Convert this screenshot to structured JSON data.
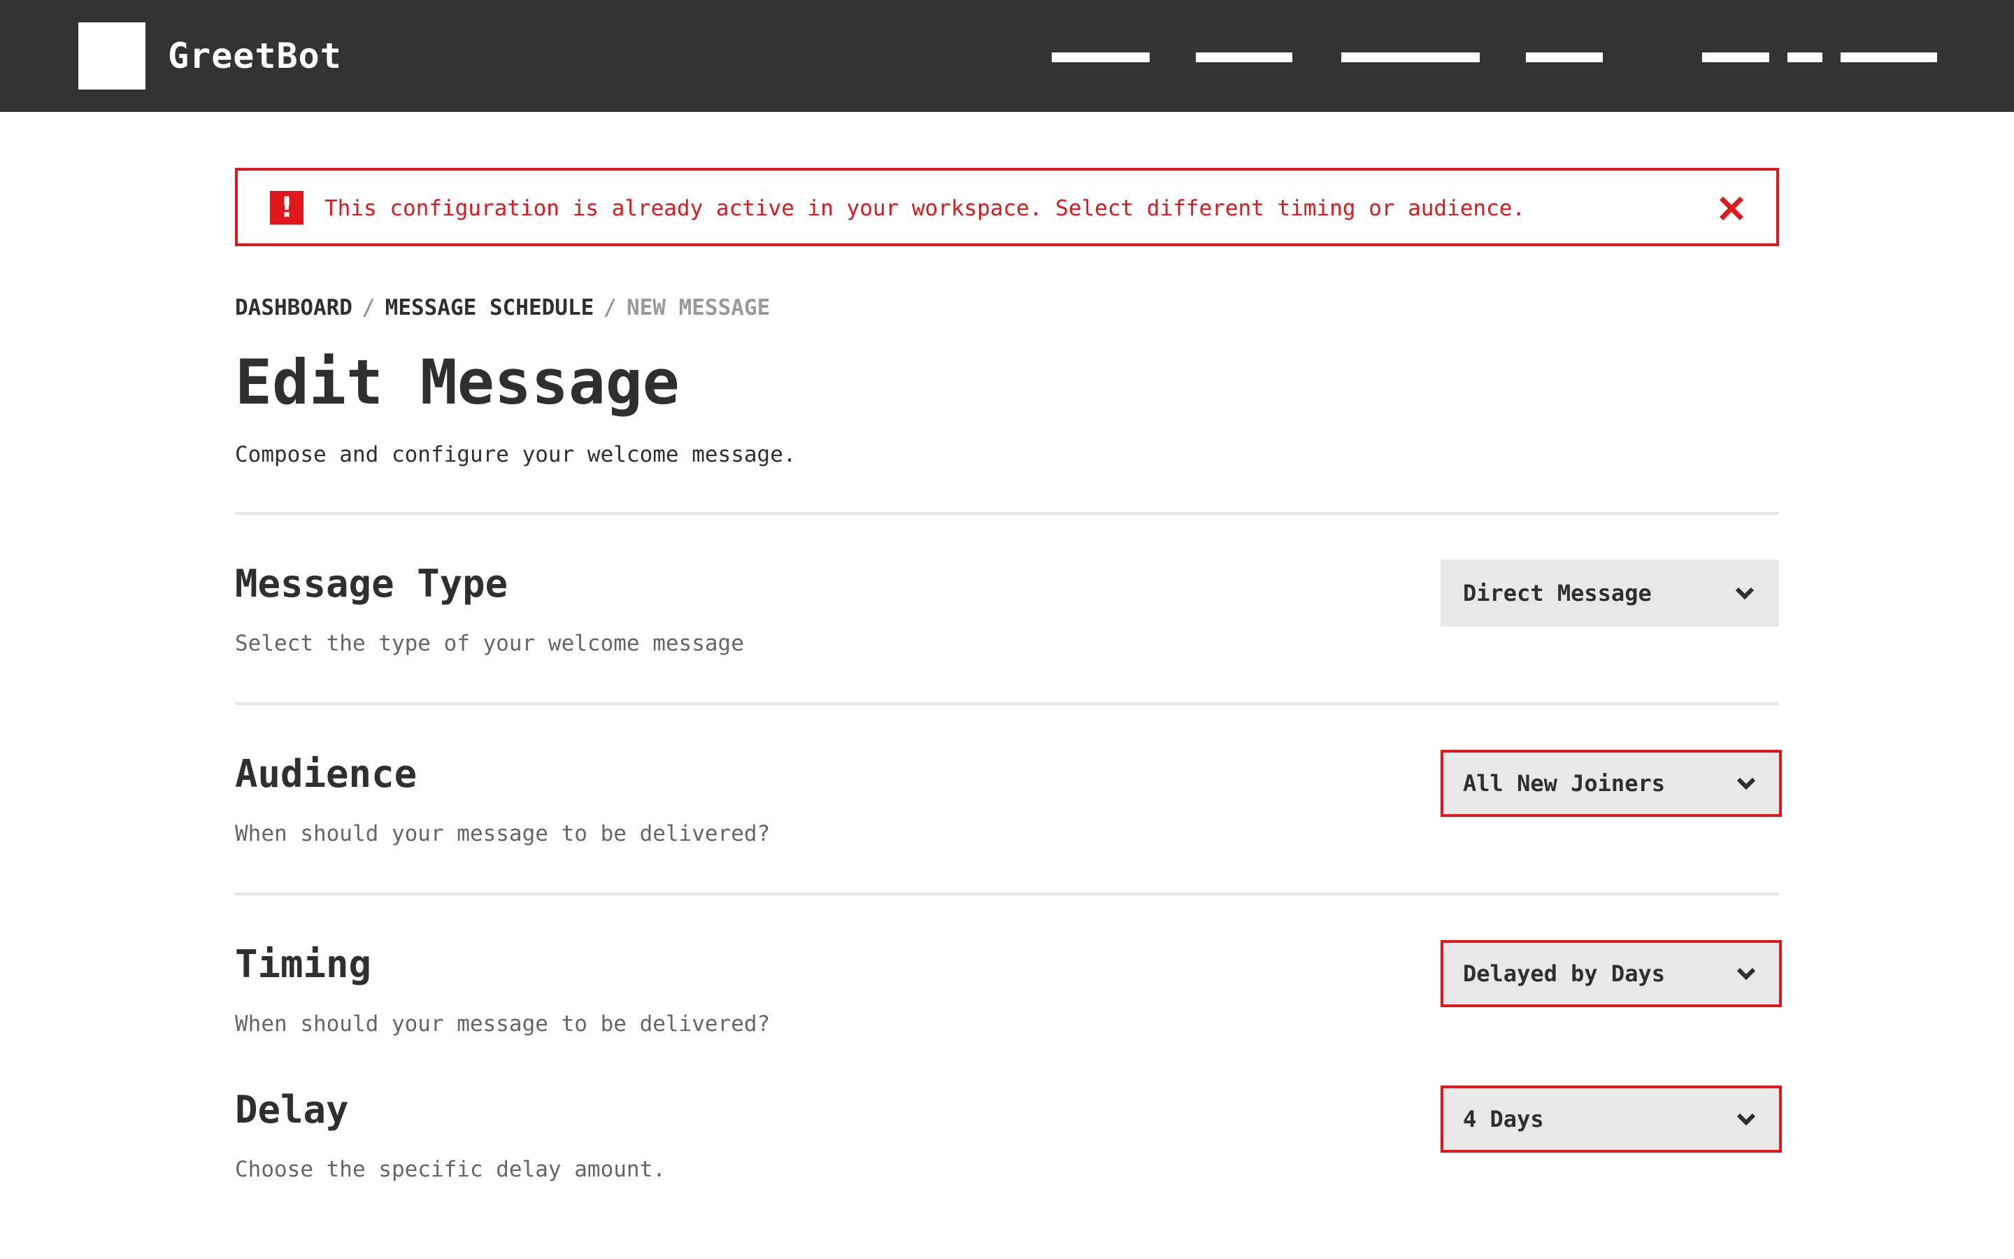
{
  "header": {
    "brand": "GreetBot",
    "nav_items": [
      "nav-link-1",
      "nav-link-2",
      "nav-link-3",
      "nav-link-4",
      "account-link-1",
      "account-link-2",
      "account-link-3"
    ]
  },
  "alert": {
    "message": "This configuration is already active in your workspace. Select different timing or audience.",
    "icon": "exclamation-icon",
    "close_icon": "close-icon",
    "color": "#e0181b"
  },
  "breadcrumb": {
    "items": [
      "DASHBOARD",
      "MESSAGE SCHEDULE"
    ],
    "separator": "/",
    "current": "NEW MESSAGE"
  },
  "page": {
    "title": "Edit Message",
    "subtitle": "Compose and configure your welcome message."
  },
  "settings": [
    {
      "title": "Message Type",
      "description": "Select the type of your welcome message",
      "value": "Direct Message",
      "has_error": false
    },
    {
      "title": "Audience",
      "description": "When should your message to be delivered?",
      "value": "All New Joiners",
      "has_error": true
    },
    {
      "title": "Timing",
      "description": "When should your message to be delivered?",
      "value": "Delayed by Days",
      "has_error": true
    },
    {
      "title": "Delay",
      "description": "Choose the specific delay amount.",
      "value": "4 Days",
      "has_error": true
    }
  ],
  "colors": {
    "header_bg": "#333333",
    "error": "#e0181b",
    "select_bg": "#e8e8e8",
    "text": "#2f2f2f"
  }
}
